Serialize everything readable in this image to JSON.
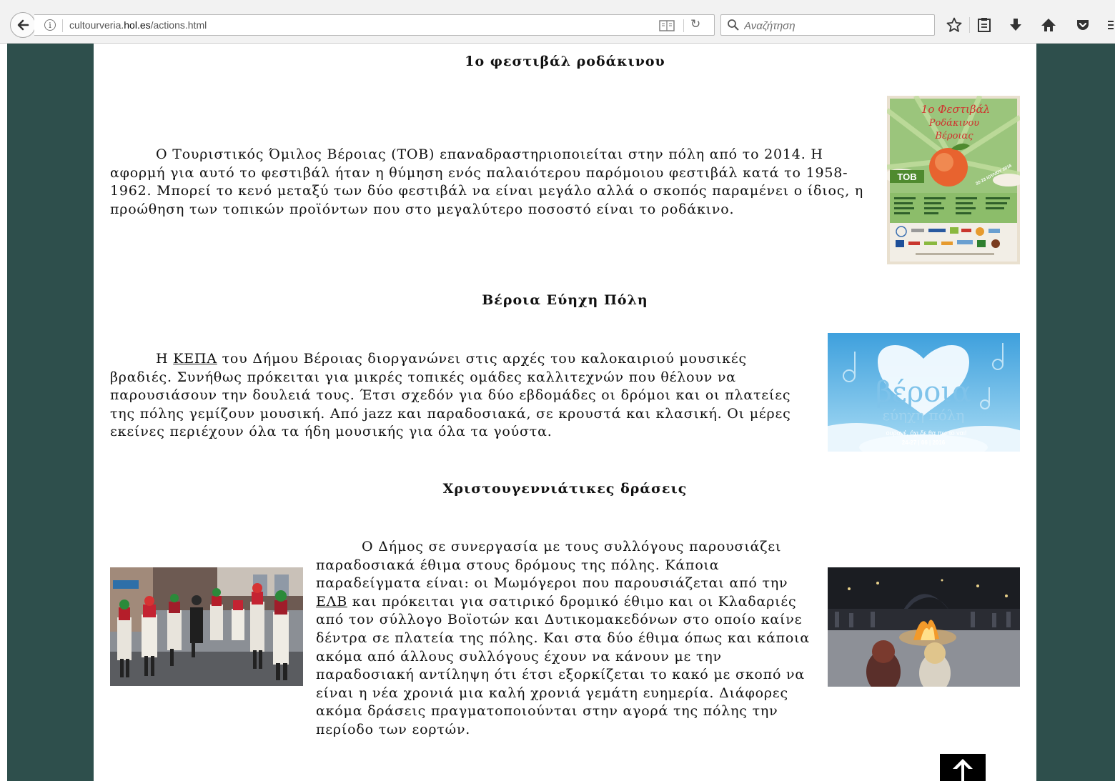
{
  "browser": {
    "url_prefix": "cultourveria.",
    "url_domain": "hol.es",
    "url_path": "/actions.html",
    "search_placeholder": "Αναζήτηση"
  },
  "sections": [
    {
      "title": "1ο φεστιβάλ ροδάκινου",
      "body": "Ο Τουριστικός Όμιλος Βέροιας (ΤΟΒ) επαναδραστηριοποιείται στην πόλη από το 2014. Η αφορμή για αυτό το φεστιβάλ ήταν η θύμηση ενός παλαιότερου παρόμοιου φεστιβάλ κατά το 1958-1962. Μπορεί το κενό μεταξύ των δύο φεστιβάλ να είναι μεγάλο αλλά ο σκοπός παραμένει ο ίδιος, η προώθηση των τοπικών προϊόντων που στο μεγαλύτερο ποσοστό είναι το ροδάκινο.",
      "poster": {
        "title_line1": "1ο Φεστιβάλ",
        "title_line2": "Ροδάκινου",
        "title_line3": "Βέροιας",
        "badge": "ΤΟΒ",
        "dates": "22-23 ΙΟΥΛΙΟΥ 2016"
      }
    },
    {
      "title": "Βέροια Εύηχη Πόλη",
      "body_before": "Η ",
      "link": "ΚΕΠΑ",
      "body_after": " του Δήμου Βέροιας διοργανώνει στις αρχές του καλοκαιριού μουσικές βραδιές. Συνήθως πρόκειται για μικρές τοπικές ομάδες καλλιτεχνών που θέλουν να παρουσιάσουν την δουλειά τους. Έτσι σχεδόν για δύο εβδομάδες οι δρόμοι και οι πλατείες της πόλης γεμίζουν μουσική. Από jazz και παραδοσιακά, σε κρουστά και κλασική. Οι μέρες εκείνες περιέχουν όλα τα ήδη μουσικής για όλα τα γούστα.",
      "poster": {
        "title": "βέροια",
        "subtitle": "εύηχη πόλη",
        "tagline": "ουρανέ, όχι δε θα πω το ναι!",
        "dates": "24-27 | 06 | 2016"
      }
    },
    {
      "title": "Χριστουγεννιάτικες δράσεις",
      "body_before": "Ο Δήμος σε συνεργασία με τους συλλόγους παρουσιάζει παραδοσιακά έθιμα στους δρόμους της πόλης. Κάποια παραδείγματα είναι: οι Μωμόγεροι που παρουσιάζεται από την ",
      "link": "ΕΛΒ",
      "body_after": " και πρόκειται για σατιρικό δρομικό έθιμο και οι Κλαδαριές από τον σύλλογο Βοϊοτών και Δυτικομακεδόνων στο οποίο καίνε δέντρα σε πλατεία της πόλης. Και στα δύο έθιμα όπως και κάποια ακόμα από άλλους συλλόγους έχουν να κάνουν με την παραδοσιακή αντίληψη ότι έτσι εξορκίζεται το κακό με σκοπό να είναι η νέα χρονιά μια καλή χρονιά γεμάτη ευημερία. Διάφορες ακόμα δράσεις πραγματοποιούνται στην αγορά της πόλης την περίοδο των εορτών."
    }
  ],
  "colors": {
    "sidebar": "#2e4f4c",
    "page_bg": "#ffffff",
    "text": "#111111"
  }
}
